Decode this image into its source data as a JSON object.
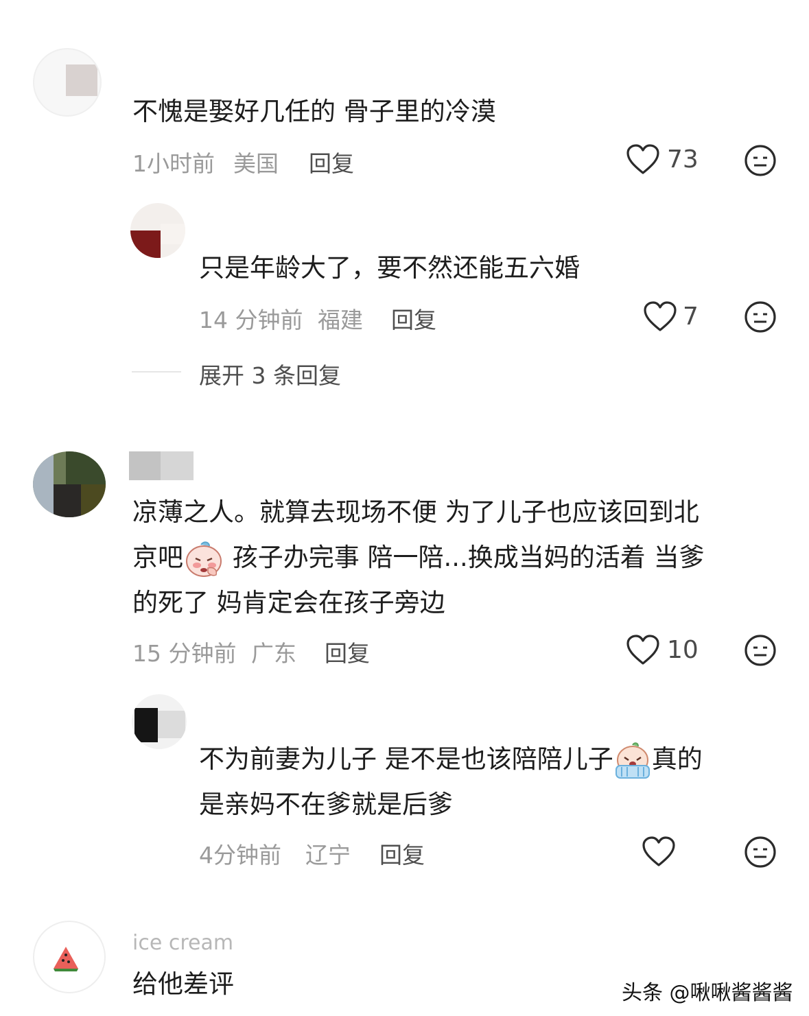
{
  "comments": [
    {
      "text": "不愧是娶好几任的 骨子里的冷漠",
      "time": "1小时前",
      "location": "美国",
      "reply_label": "回复",
      "likes": "73"
    },
    {
      "text": "只是年龄大了，要不然还能五六婚",
      "time": "14 分钟前",
      "location": "福建",
      "reply_label": "回复",
      "likes": "7"
    },
    {
      "expand_label": "展开 3 条回复"
    },
    {
      "line1": "凉薄之人。就算去现场不便 为了儿子也应该回到北",
      "line2_a": "京吧",
      "line2_b": " 孩子办完事 陪一陪...换成当妈的活着 当爹",
      "line3": "的死了 妈肯定会在孩子旁边",
      "time": "15 分钟前",
      "location": "广东",
      "reply_label": "回复",
      "likes": "10"
    },
    {
      "line1_a": "不为前妻为儿子 是不是也该陪陪儿子",
      "line1_b": "真的",
      "line2": "是亲妈不在爹就是后爹",
      "time": "4分钟前",
      "location": "辽宁",
      "reply_label": "回复"
    },
    {
      "username": "ice cream",
      "text": "给他差评"
    }
  ],
  "watermark": "头条 @啾啾酱酱酱",
  "colors": {
    "meta": "#9a9a9a",
    "text": "#1d1d1d",
    "icon": "#2b2b2b"
  }
}
